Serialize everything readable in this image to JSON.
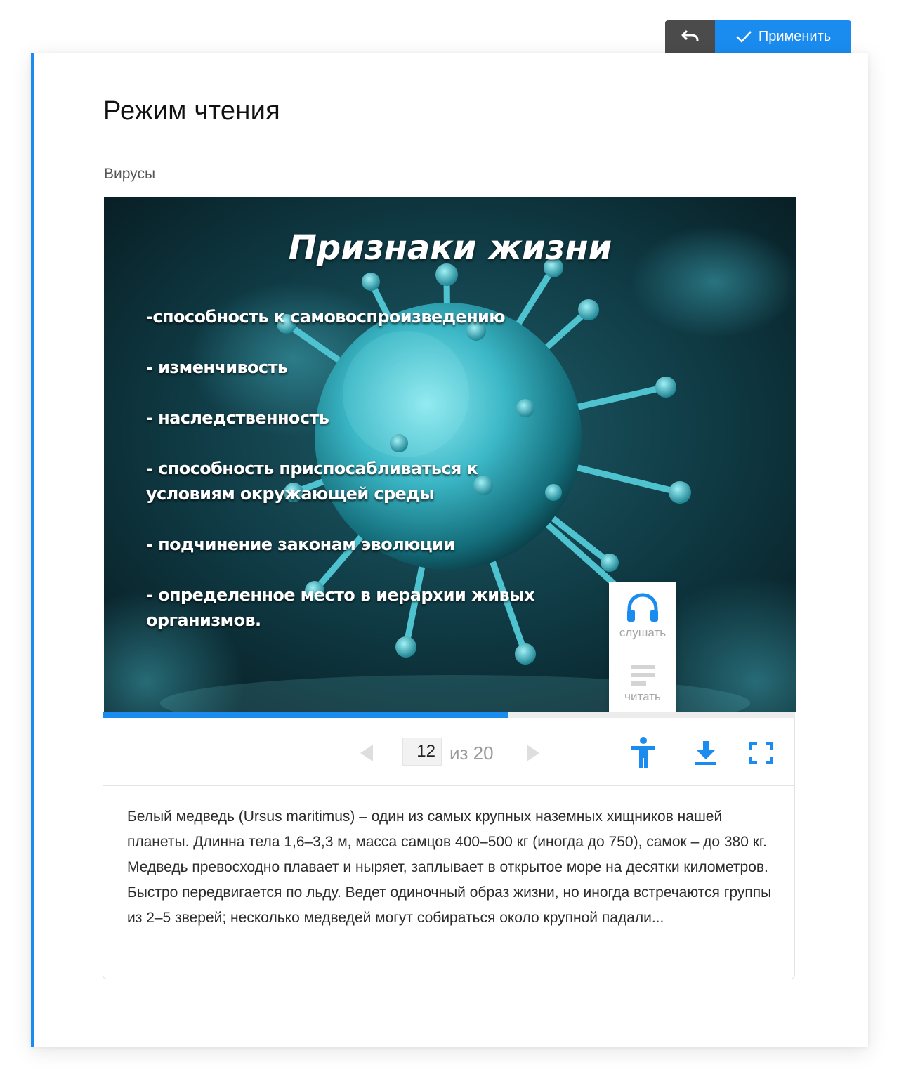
{
  "toolbar": {
    "undo_icon": "undo-icon",
    "apply_icon": "check-icon",
    "apply_label": "Применить",
    "accent_color": "#1a8cf0"
  },
  "page": {
    "title": "Режим чтения",
    "section_label": "Вирусы"
  },
  "slide": {
    "title": "Признаки жизни",
    "items": [
      "-способность к самовоспроизведению",
      "- изменчивость",
      "- наследственность",
      "- способность приспосабливаться к условиям окружающей среды",
      "- подчинение законам эволюции",
      "- определенное место в иерархии живых организмов."
    ]
  },
  "side_tools": {
    "listen_label": "слушать",
    "listen_icon": "headphones-icon",
    "read_label": "читать",
    "read_icon": "text-lines-icon"
  },
  "progress": {
    "fraction": 0.585
  },
  "pager": {
    "current": "12",
    "of_label": "из 20"
  },
  "tools": {
    "accessibility_icon": "accessibility-icon",
    "download_icon": "download-icon",
    "fullscreen_icon": "fullscreen-icon"
  },
  "description": "Белый медведь (Ursus maritimus) – один из самых крупных наземных хищников нашей планеты. Длинна тела 1,6–3,3 м, масса самцов 400–500 кг (иногда до 750), самок – до 380 кг. Медведь превосходно плавает и ныряет, заплывает в открытое море на десятки километров. Быстро передвигается по льду. Ведет одиночный образ жизни, но иногда встречаются группы из 2–5 зверей; несколько медведей могут собираться около крупной падали..."
}
